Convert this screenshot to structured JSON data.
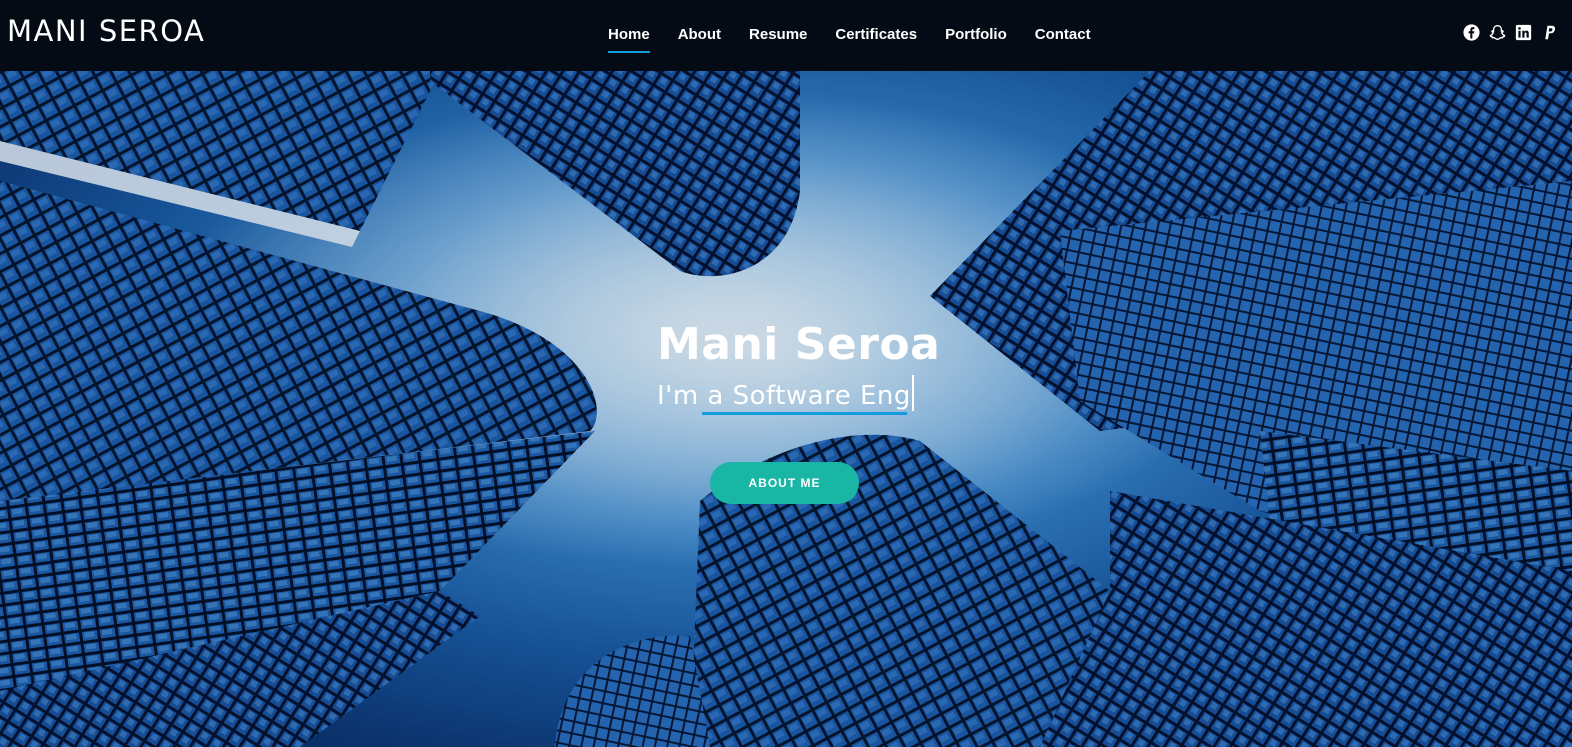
{
  "header": {
    "logo_text": "MANI SEROA",
    "nav": {
      "home": "Home",
      "about": "About",
      "resume": "Resume",
      "certificates": "Certificates",
      "portfolio": "Portfolio",
      "contact": "Contact"
    },
    "active_nav": "Home",
    "social_icons": [
      "facebook-icon",
      "snapchat-icon",
      "linkedin-icon",
      "paypal-icon"
    ]
  },
  "hero": {
    "title": "Mani Seroa",
    "subtitle_typed": "I'm a Software Eng",
    "button_label": "ABOUT ME"
  },
  "colors": {
    "header_bg": "#040b14",
    "accent": "#149ddd",
    "button": "#19b6a6",
    "text": "#ffffff"
  }
}
